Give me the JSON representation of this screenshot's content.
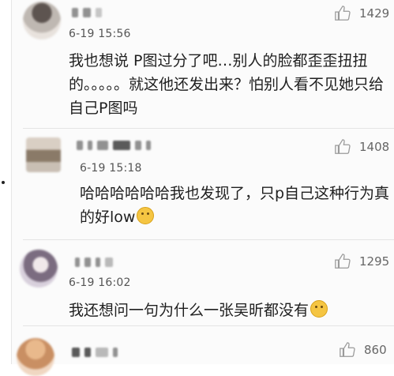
{
  "comments": [
    {
      "time": "6-19 15:56",
      "text": "我也想说 P图过分了吧…别人的脸都歪歪扭扭的。。。。。就这他还发出来？怕别人看不见她只给自己P图吗",
      "likes": "1429"
    },
    {
      "time": "6-19 15:18",
      "text": "哈哈哈哈哈哈我也发现了，只p自己这种行为真的好low",
      "likes": "1408",
      "emoji": "smile-emoji-icon"
    },
    {
      "time": "6-19 16:02",
      "text": "我还想问一句为什么一张吴昕都没有",
      "likes": "1295",
      "emoji": "question-emoji-icon"
    },
    {
      "time": "",
      "text": "",
      "likes": "860"
    }
  ],
  "colors": {
    "like_icon": "#9a9a9a",
    "emoji": "#f5c542"
  }
}
